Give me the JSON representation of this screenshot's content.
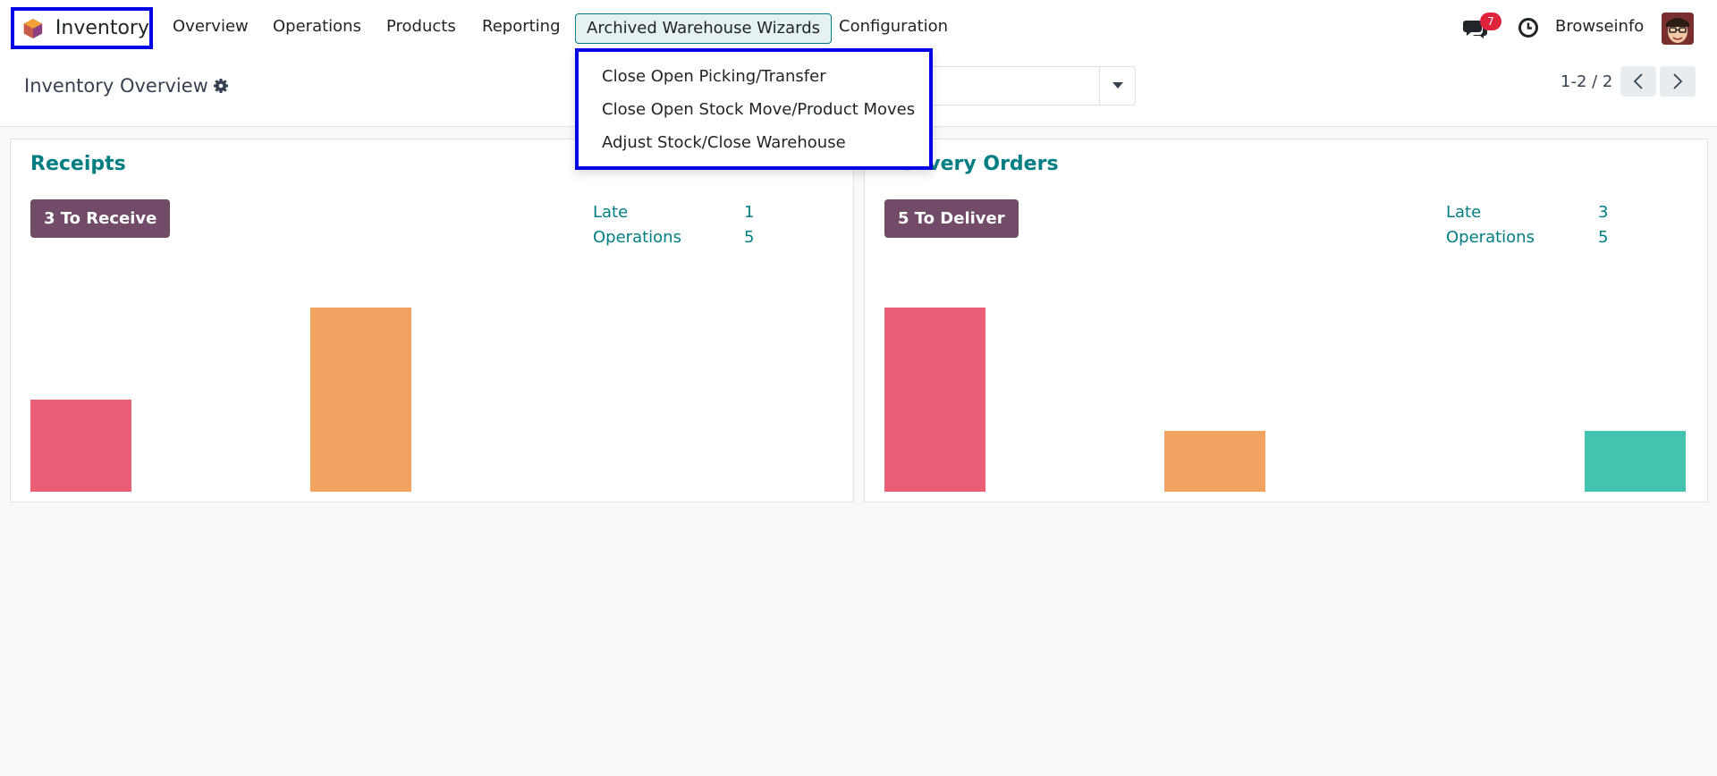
{
  "navbar": {
    "brand": "Inventory",
    "menu": [
      {
        "label": "Overview"
      },
      {
        "label": "Operations"
      },
      {
        "label": "Products"
      },
      {
        "label": "Reporting"
      },
      {
        "label": "Archived Warehouse Wizards"
      },
      {
        "label": "Configuration"
      }
    ],
    "chat_count": "7",
    "company": "Browseinfo"
  },
  "dropdown": {
    "items": [
      {
        "label": "Close Open Picking/Transfer"
      },
      {
        "label": "Close Open Stock Move/Product Moves"
      },
      {
        "label": "Adjust Stock/Close Warehouse"
      }
    ]
  },
  "control_panel": {
    "title": "Inventory Overview",
    "pager": "1-2 / 2"
  },
  "cards": [
    {
      "title": "Receipts",
      "button": "3 To Receive",
      "stats": [
        {
          "label": "Late",
          "value": "1"
        },
        {
          "label": "Operations",
          "value": "5"
        }
      ],
      "bars": [
        {
          "color": "#e95f75",
          "level": 0.5
        },
        {
          "color": "#f2a361",
          "level": 1.0
        }
      ]
    },
    {
      "title": "Delivery Orders",
      "button": "5 To Deliver",
      "stats": [
        {
          "label": "Late",
          "value": "3"
        },
        {
          "label": "Operations",
          "value": "5"
        }
      ],
      "bars": [
        {
          "color": "#e95f75",
          "level": 1.0
        },
        {
          "color": "#f2a361",
          "level": 0.33
        },
        {
          "color": "#44c3b1",
          "level": 0.33
        }
      ]
    }
  ],
  "colors": {
    "accent": "#017e84",
    "primary": "#714b67",
    "highlight": "#0000e6"
  }
}
